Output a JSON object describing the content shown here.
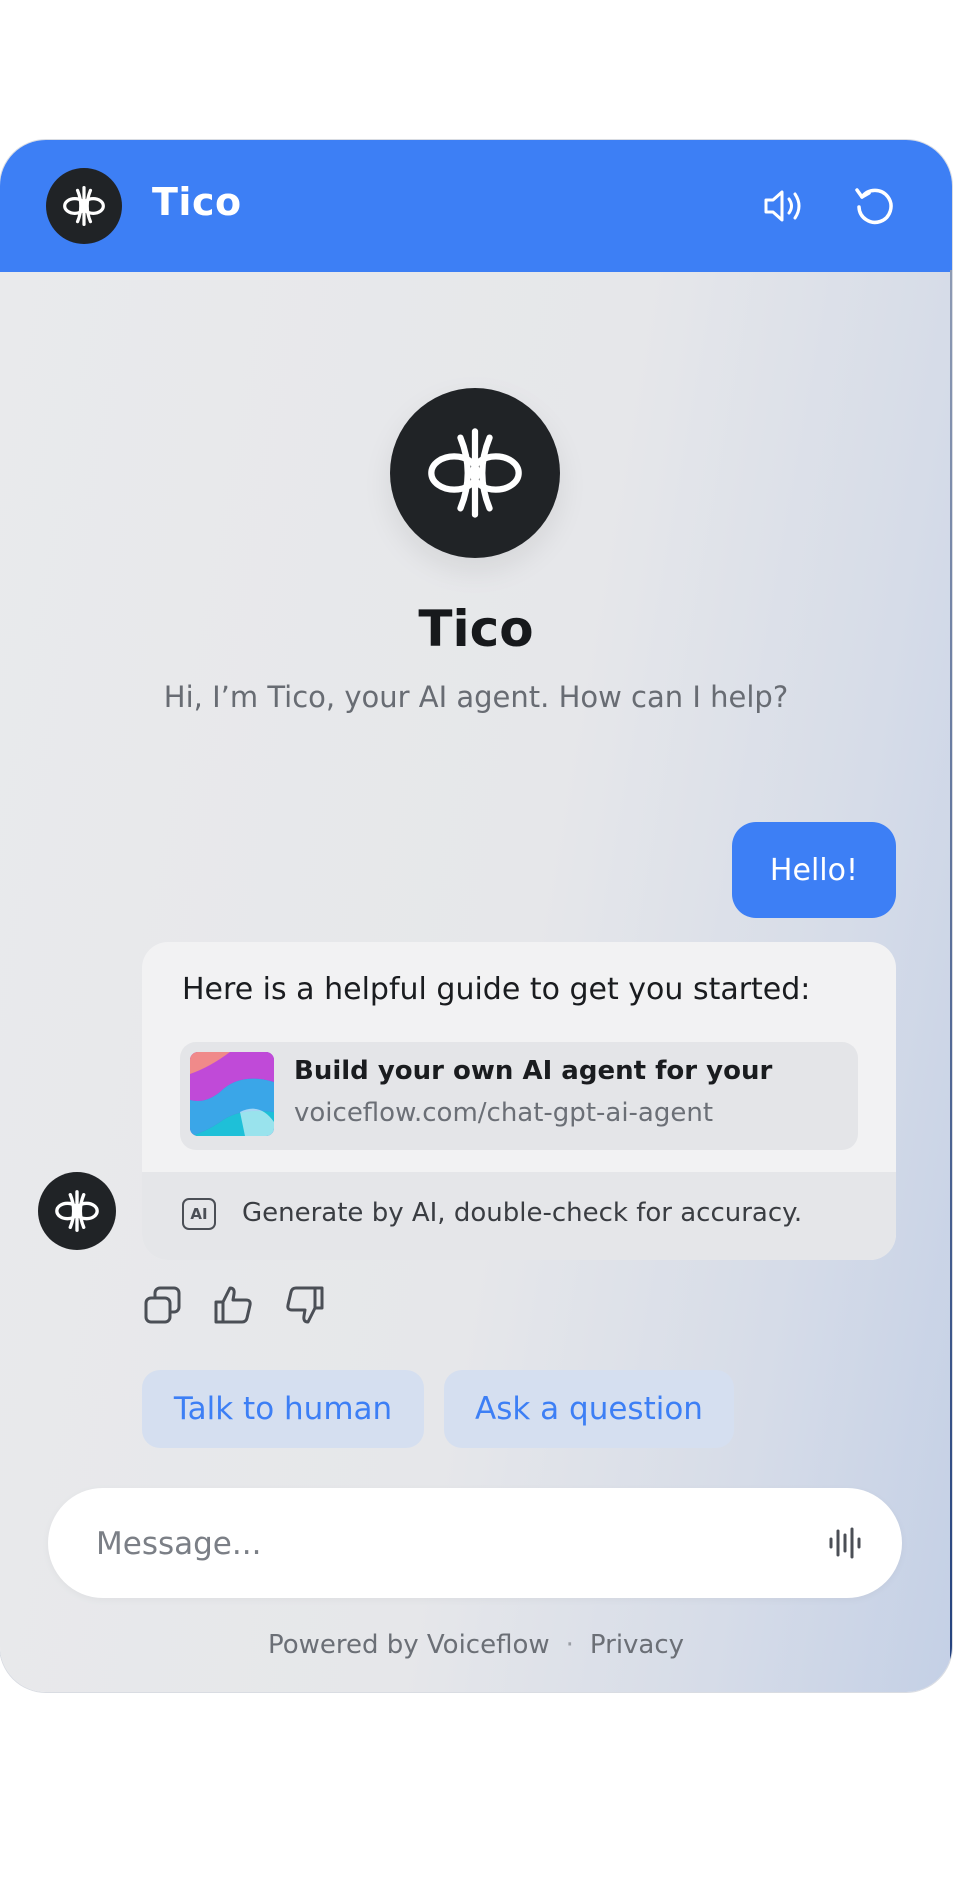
{
  "header": {
    "title": "Tico",
    "logo_icon": "tico-logo-icon",
    "sound_icon": "speaker-icon",
    "reset_icon": "refresh-icon",
    "background_color": "#3d7ff5"
  },
  "hero": {
    "name": "Tico",
    "greeting": "Hi, I’m Tico, your AI agent. How can I help?"
  },
  "conversation": {
    "user_message": "Hello!",
    "bot_message": {
      "text": "Here is a helpful guide to get you started:",
      "link_card": {
        "title": "Build your own AI agent for your",
        "url": "voiceflow.com/chat-gpt-ai-agent"
      },
      "ai_badge": "AI",
      "ai_notice": "Generate by AI, double-check for accuracy."
    },
    "feedback_icons": [
      "copy-icon",
      "thumbs-up-icon",
      "thumbs-down-icon"
    ]
  },
  "quick_replies": [
    "Talk to human",
    "Ask a question"
  ],
  "composer": {
    "placeholder": "Message...",
    "mic_icon": "voice-wave-icon"
  },
  "footer": {
    "powered_by": "Powered by Voiceflow",
    "separator": "·",
    "privacy": "Privacy"
  },
  "colors": {
    "accent": "#3d7ff5",
    "quick_reply_bg": "#d5dff0",
    "avatar_bg": "#202326"
  }
}
